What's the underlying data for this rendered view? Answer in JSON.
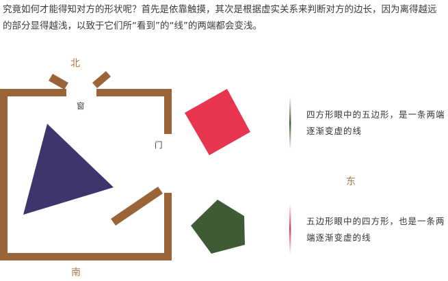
{
  "paragraph": {
    "line1": "究竟如何才能得知对方的形状呢？首先是依靠触摸，其次是根据虚实关系来判断对方的边长，因为离得越远",
    "line2": "的部分显得越浅，以致于它们所“看到”的“线”的两端都会变浅。"
  },
  "figure": {
    "compass": {
      "north": "北",
      "south": "南",
      "east": "东"
    },
    "labels": {
      "window": "窗",
      "door": "门"
    },
    "captions": {
      "upper": "四方形眼中的五边形，是一条两端逐渐变虚的线",
      "lower": "五边形眼中的四方形，也是一条两端逐渐变虚的线"
    },
    "colors": {
      "wall": "#9a6338",
      "triangle": "#3e356d",
      "square": "#e8344e",
      "pentagon": "#3f5b36",
      "compass_text": "#b0784a"
    }
  }
}
